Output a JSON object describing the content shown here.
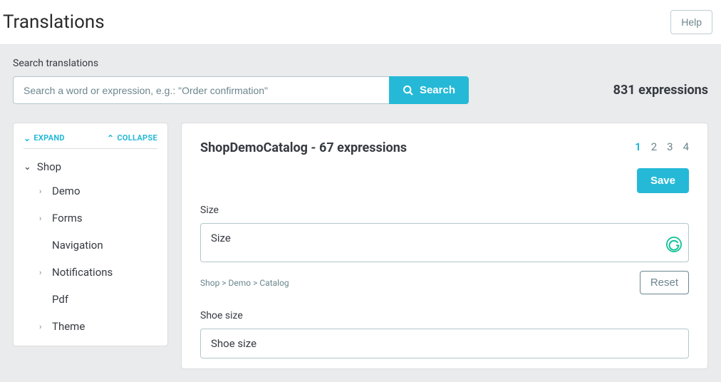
{
  "header": {
    "title": "Translations",
    "help": "Help"
  },
  "search": {
    "label": "Search translations",
    "placeholder": "Search a word or expression, e.g.: \"Order confirmation\"",
    "button": "Search",
    "count": "831 expressions"
  },
  "sidebar": {
    "expand": "EXPAND",
    "collapse": "COLLAPSE",
    "root": "Shop",
    "items": [
      {
        "label": "Demo",
        "children": true
      },
      {
        "label": "Forms",
        "children": true
      },
      {
        "label": "Navigation",
        "children": false
      },
      {
        "label": "Notifications",
        "children": true
      },
      {
        "label": "Pdf",
        "children": false
      },
      {
        "label": "Theme",
        "children": true
      }
    ]
  },
  "main": {
    "title": "ShopDemoCatalog - 67 expressions",
    "pages": [
      "1",
      "2",
      "3",
      "4"
    ],
    "active_page": "1",
    "save": "Save",
    "reset": "Reset",
    "breadcrumb": "Shop > Demo > Catalog",
    "fields": [
      {
        "label": "Size",
        "value": "Size",
        "grammarly": true,
        "reset": true
      },
      {
        "label": "Shoe size",
        "value": "Shoe size",
        "grammarly": false,
        "reset": false
      }
    ]
  }
}
